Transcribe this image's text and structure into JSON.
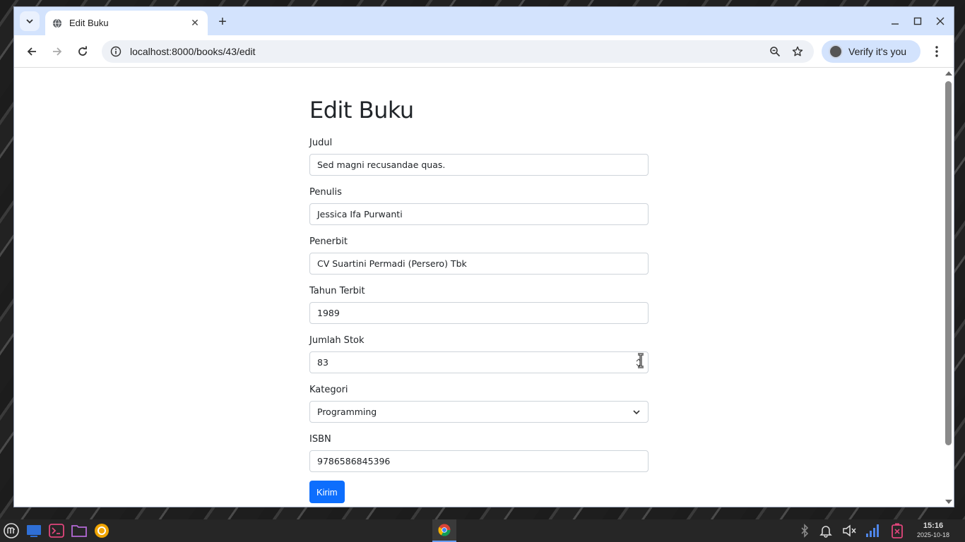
{
  "browser": {
    "tab_title": "Edit Buku",
    "url": "localhost:8000/books/43/edit",
    "profile_button": "Verify it's you"
  },
  "page": {
    "heading": "Edit Buku",
    "fields": {
      "judul": {
        "label": "Judul",
        "value": "Sed magni recusandae quas."
      },
      "penulis": {
        "label": "Penulis",
        "value": "Jessica Ifa Purwanti"
      },
      "penerbit": {
        "label": "Penerbit",
        "value": "CV Suartini Permadi (Persero) Tbk"
      },
      "tahun": {
        "label": "Tahun Terbit",
        "value": "1989"
      },
      "stok": {
        "label": "Jumlah Stok",
        "value": "83"
      },
      "kategori": {
        "label": "Kategori",
        "value": "Programming"
      },
      "isbn": {
        "label": "ISBN",
        "value": "9786586845396"
      }
    },
    "submit_label": "Kirim"
  },
  "taskbar": {
    "time": "15:16",
    "date": "2025-10-18"
  },
  "colors": {
    "primary_button": "#0d6efd",
    "tabstrip": "#d3e3fd",
    "taskbar": "#262626"
  }
}
